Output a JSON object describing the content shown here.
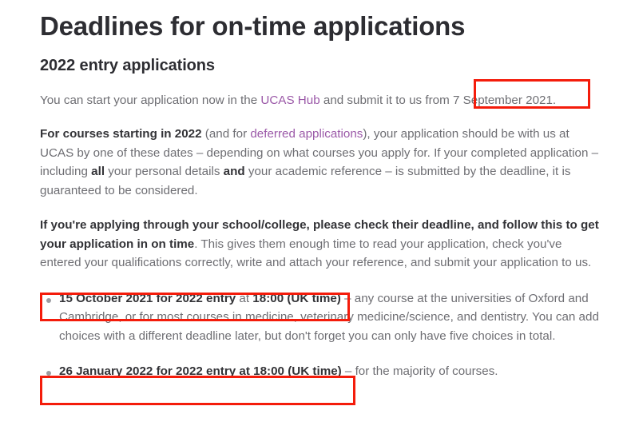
{
  "document": {
    "title": "Deadlines for on-time applications",
    "section_heading": "2022 entry applications"
  },
  "paragraphs": {
    "p1": {
      "part_1": "You can start your application now in the ",
      "link_ucas_hub": "UCAS Hub",
      "part_2": " and submit it to us from ",
      "highlighted_date": "7 September 2021."
    },
    "p2": {
      "bold_lead": "For courses starting in 2022",
      "part_1": " (and for ",
      "link_deferred": "deferred applications",
      "part_2": "), your application should be with us at UCAS by one of these dates – depending on what courses you apply for. If your completed application – including ",
      "bold_all": "all",
      "part_3": " your personal details ",
      "bold_and": "and",
      "part_4": " your academic reference – is submitted by the deadline, it is guaranteed to be considered."
    },
    "p3": {
      "bold_lead": "If you're applying through your school/college, please check their deadline, and follow this to get your application in on time",
      "rest": ". This gives them enough time to read your application, check you've entered your qualifications correctly, write and attach your reference, and submit your application to us."
    }
  },
  "deadlines": [
    {
      "bold_date": "15 October 2021 for 2022 entry",
      "connector": " at ",
      "bold_time": "18:00 (UK time)",
      "description": " – any course at the universities of Oxford and Cambridge, or for most courses in medicine, veterinary medicine/science, and dentistry. You can add choices with a different deadline later, but don't forget you can only have five choices in total."
    },
    {
      "bold_date": "26 January 2022 for 2022 entry at 18:00 (UK time)",
      "connector": "",
      "bold_time": "",
      "description": " – for the majority of courses."
    }
  ],
  "annotations": {
    "highlight_color": "#f41c0b",
    "boxes": [
      {
        "label": "7 September 2021."
      },
      {
        "label": "15 October 2021 for 2022 entry at 18:00 (UK time)"
      },
      {
        "label": "26 January 2022 for 2022 entry at 18:00 (UK time)"
      }
    ]
  },
  "colors": {
    "heading": "#2d2d32",
    "body": "#6e6e73",
    "bold": "#333337",
    "link": "#9b59a8",
    "bullet": "#9c9ca1",
    "background": "#ffffff"
  }
}
